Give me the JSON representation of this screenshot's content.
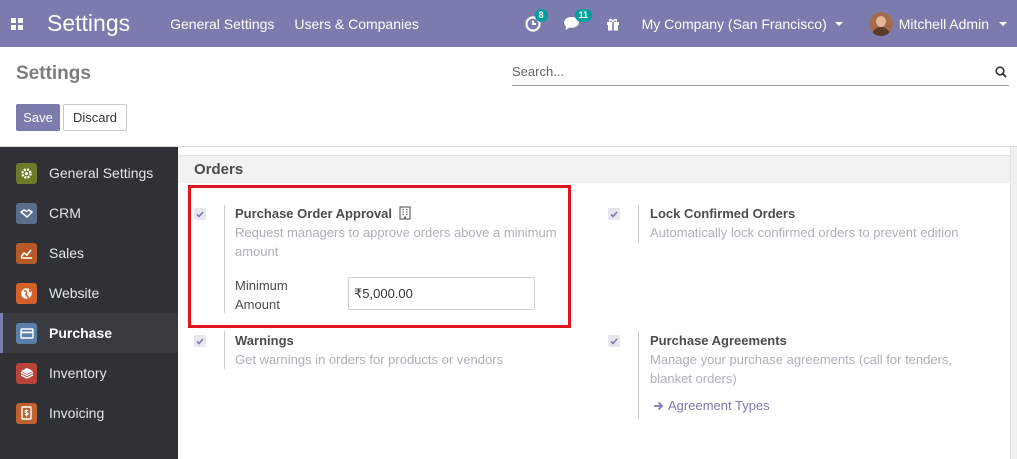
{
  "navbar": {
    "brand": "Settings",
    "menu": [
      "General Settings",
      "Users & Companies"
    ],
    "activity_count": "8",
    "messages_count": "11",
    "company": "My Company (San Francisco)",
    "user": "Mitchell Admin"
  },
  "control_panel": {
    "title": "Settings",
    "search_placeholder": "Search...",
    "save_label": "Save",
    "discard_label": "Discard"
  },
  "sidebar": {
    "items": [
      {
        "label": "General Settings",
        "icon": "gear-icon",
        "color": "#6c7a2a"
      },
      {
        "label": "CRM",
        "icon": "handshake-icon",
        "color": "#5a6e8c"
      },
      {
        "label": "Sales",
        "icon": "chart-icon",
        "color": "#b65a28"
      },
      {
        "label": "Website",
        "icon": "globe-icon",
        "color": "#d4602a"
      },
      {
        "label": "Purchase",
        "icon": "credit-card-icon",
        "color": "#5a7fa8"
      },
      {
        "label": "Inventory",
        "icon": "box-icon",
        "color": "#b8433a"
      },
      {
        "label": "Invoicing",
        "icon": "invoice-icon",
        "color": "#c0622d"
      }
    ],
    "active_index": 4
  },
  "section": {
    "title": "Orders",
    "settings": {
      "po_approval": {
        "title": "Purchase Order Approval",
        "description": "Request managers to approve orders above a minimum amount",
        "min_amount_label": "Minimum Amount",
        "min_amount_value": "₹5,000.00",
        "checked": true
      },
      "lock_orders": {
        "title": "Lock Confirmed Orders",
        "description": "Automatically lock confirmed orders to prevent edition",
        "checked": true
      },
      "warnings": {
        "title": "Warnings",
        "description": "Get warnings in orders for products or vendors",
        "checked": true
      },
      "agreements": {
        "title": "Purchase Agreements",
        "description": "Manage your purchase agreements (call for tenders, blanket orders)",
        "link_label": "Agreement Types",
        "checked": true
      }
    }
  },
  "colors": {
    "navbar": "#7c7bad",
    "sidebar": "#2f3136",
    "highlight": "#e0151f"
  }
}
